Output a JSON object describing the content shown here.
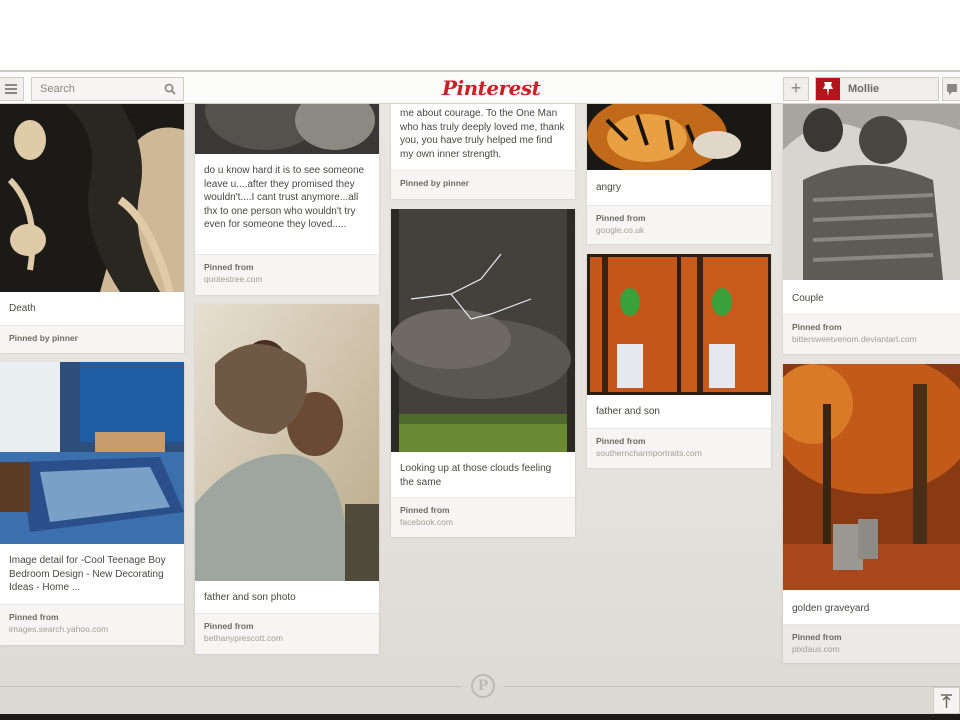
{
  "header": {
    "search_placeholder": "Search",
    "logo_text": "Pinterest",
    "user_name": "Mollie",
    "add_icon": "+",
    "accent_color": "#cb2027"
  },
  "pins": [
    {
      "desc": "",
      "pinned_label": "",
      "source": ""
    },
    {
      "desc": "Death",
      "pinned_label": "Pinned by pinner",
      "source": ""
    },
    {
      "desc": "Image detail for -Cool Teenage Boy Bedroom Design - New Decorating Ideas - Home ...",
      "pinned_label": "Pinned from",
      "source": "images.search.yahoo.com"
    },
    {
      "desc": "do u know hard it is to see someone leave u....after they promised they wouldn't....I cant trust anymore...all thx to one person who wouldn't try even for someone they loved.....",
      "pinned_label": "Pinned from",
      "source": "quotestree.com"
    },
    {
      "desc": "father and son photo",
      "pinned_label": "Pinned from",
      "source": "bethanyprescott.com"
    },
    {
      "desc": "me about courage. To the One Man who has truly deeply loved me, thank you, you have truly helped me find my own inner strength.",
      "pinned_label": "Pinned by pinner",
      "source": ""
    },
    {
      "desc": "Looking up at those clouds feeling the same",
      "pinned_label": "Pinned from",
      "source": "facebook.com"
    },
    {
      "desc": "angry",
      "pinned_label": "Pinned from",
      "source": "google.co.uk"
    },
    {
      "desc": "father and son",
      "pinned_label": "Pinned from",
      "source": "southerncharmportraits.com"
    },
    {
      "desc": "Couple",
      "pinned_label": "Pinned from",
      "source": "bittersweetvenom.deviantart.com"
    },
    {
      "desc": "golden graveyard",
      "pinned_label": "Pinned from",
      "source": "pixdaus.com"
    }
  ],
  "footer": {
    "logo_letter": "P",
    "scroll_top_icon": "↥"
  }
}
